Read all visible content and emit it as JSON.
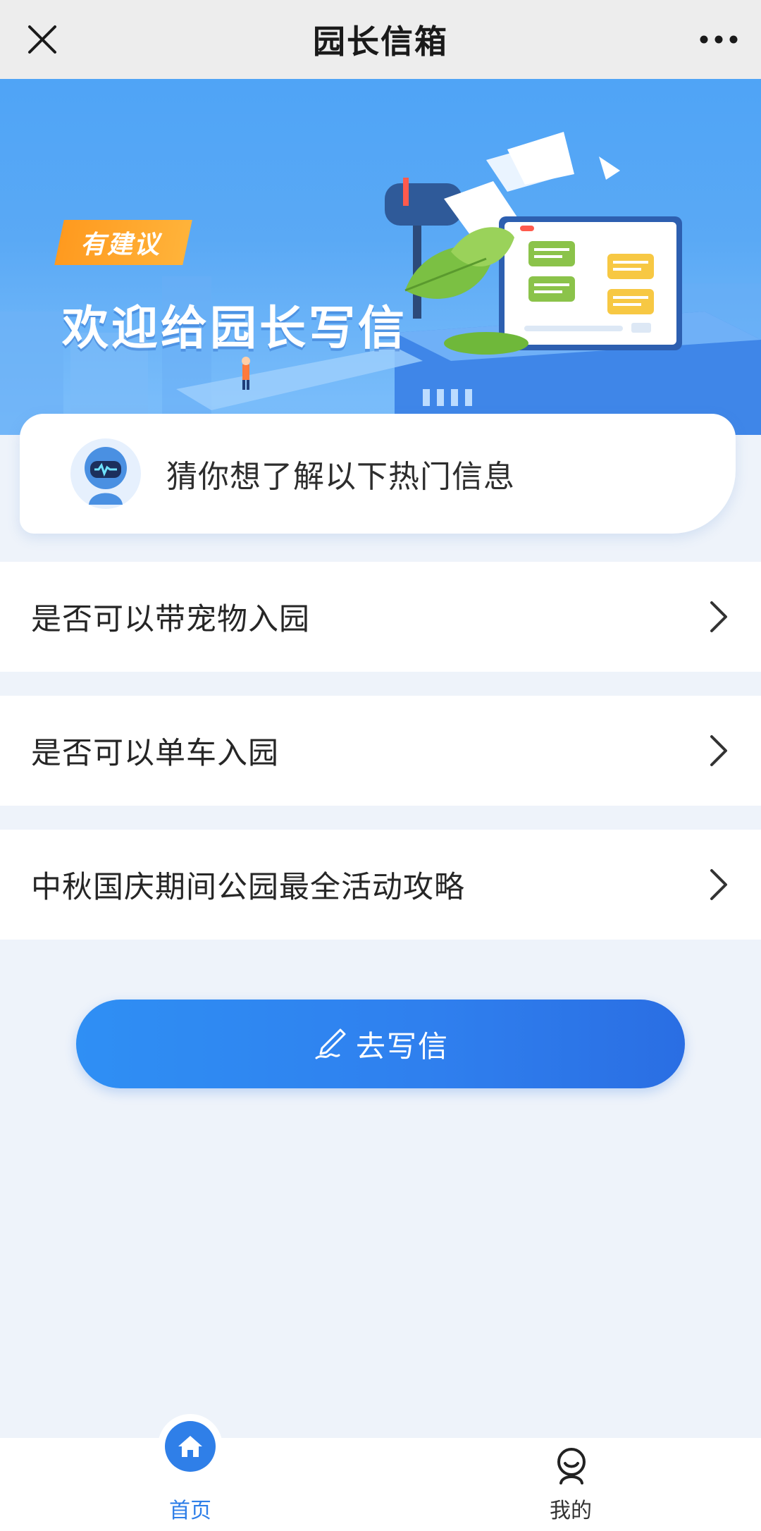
{
  "header": {
    "title": "园长信箱",
    "close_icon": "close-icon",
    "more_icon": "more-icon"
  },
  "banner": {
    "tag": "有建议",
    "headline": "欢迎给园长写信"
  },
  "hint": {
    "text": "猜你想了解以下热门信息",
    "avatar_icon": "robot-avatar-icon"
  },
  "faq": {
    "items": [
      {
        "label": "是否可以带宠物入园"
      },
      {
        "label": "是否可以单车入园"
      },
      {
        "label": "中秋国庆期间公园最全活动攻略"
      }
    ]
  },
  "cta": {
    "label": "去写信",
    "icon": "pen-icon"
  },
  "tabbar": {
    "tabs": [
      {
        "label": "首页",
        "icon": "home-icon",
        "active": true
      },
      {
        "label": "我的",
        "icon": "profile-icon",
        "active": false
      }
    ]
  },
  "colors": {
    "accent": "#2f7fe8",
    "banner_blue": "#4fa4f6",
    "tag_orange": "#ff9a1f",
    "page_bg": "#eef3fa"
  }
}
